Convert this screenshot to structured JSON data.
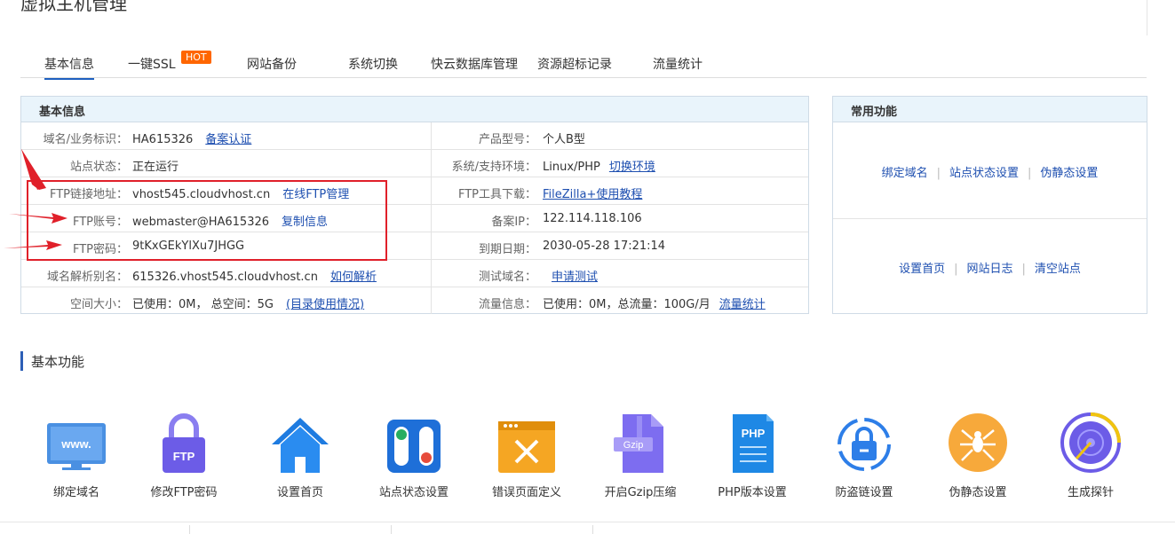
{
  "page_title": "虚拟主机管理",
  "tabs": [
    {
      "label": "基本信息"
    },
    {
      "label": "一键SSL"
    },
    {
      "label": "网站备份"
    },
    {
      "label": "系统切换"
    },
    {
      "label": "快云数据库管理"
    },
    {
      "label": "资源超标记录"
    },
    {
      "label": "流量统计"
    }
  ],
  "hot_badge": "HOT",
  "basic_info": {
    "title": "基本信息",
    "rows": [
      {
        "l_label": "域名/业务标识：",
        "l_value": "HA615326",
        "l_link": "备案认证",
        "r_label": "产品型号：",
        "r_value": "个人B型",
        "r_link": ""
      },
      {
        "l_label": "站点状态：",
        "l_value": "正在运行",
        "l_link": "",
        "r_label": "系统/支持环境：",
        "r_value": "Linux/PHP",
        "r_link": "切换环境"
      },
      {
        "l_label": "FTP链接地址：",
        "l_value": "vhost545.cloudvhost.cn",
        "l_link": "在线FTP管理",
        "r_label": "FTP工具下载：",
        "r_value": "",
        "r_link": "FileZilla+使用教程"
      },
      {
        "l_label": "FTP账号：",
        "l_value": "webmaster@HA615326",
        "l_link": "复制信息",
        "r_label": "备案IP：",
        "r_value": "122.114.118.106",
        "r_link": ""
      },
      {
        "l_label": "FTP密码：",
        "l_value": "9tKxGEkYlXu7JHGG",
        "l_link": "",
        "r_label": "到期日期：",
        "r_value": "2030-05-28 17:21:14",
        "r_link": ""
      },
      {
        "l_label": "域名解析别名：",
        "l_value": "615326.vhost545.cloudvhost.cn",
        "l_link": "如何解析",
        "r_label": "测试域名：",
        "r_value": "",
        "r_link": "申请测试"
      },
      {
        "l_label": "空间大小：",
        "l_value": "已使用：0M， 总空间：5G",
        "l_link": "(目录使用情况)",
        "r_label": "流量信息：",
        "r_value": "已使用：0M，总流量：100G/月",
        "r_link": "流量统计"
      }
    ]
  },
  "common_functions": {
    "title": "常用功能",
    "row1": [
      "绑定域名",
      "站点状态设置",
      "伪静态设置"
    ],
    "row2": [
      "设置首页",
      "网站日志",
      "清空站点"
    ]
  },
  "basic_features": {
    "title": "基本功能",
    "items": [
      {
        "label": "绑定域名",
        "icon": "www-monitor-icon",
        "icon_text": "www."
      },
      {
        "label": "修改FTP密码",
        "icon": "ftp-lock-icon",
        "icon_text": "FTP"
      },
      {
        "label": "设置首页",
        "icon": "home-icon",
        "icon_text": ""
      },
      {
        "label": "站点状态设置",
        "icon": "toggle-switch-icon",
        "icon_text": ""
      },
      {
        "label": "错误页面定义",
        "icon": "error-page-icon",
        "icon_text": ""
      },
      {
        "label": "开启Gzip压缩",
        "icon": "gzip-file-icon",
        "icon_text": "Gzip"
      },
      {
        "label": "PHP版本设置",
        "icon": "php-file-icon",
        "icon_text": "PHP"
      },
      {
        "label": "防盗链设置",
        "icon": "anti-leech-link-icon",
        "icon_text": ""
      },
      {
        "label": "伪静态设置",
        "icon": "spider-icon",
        "icon_text": ""
      },
      {
        "label": "生成探针",
        "icon": "probe-target-icon",
        "icon_text": ""
      }
    ]
  },
  "colors": {
    "link": "#1e4fb0",
    "annotation_red": "#e0202a",
    "hot_badge": "#ff6600",
    "panel_header": "#e9f4fb"
  }
}
